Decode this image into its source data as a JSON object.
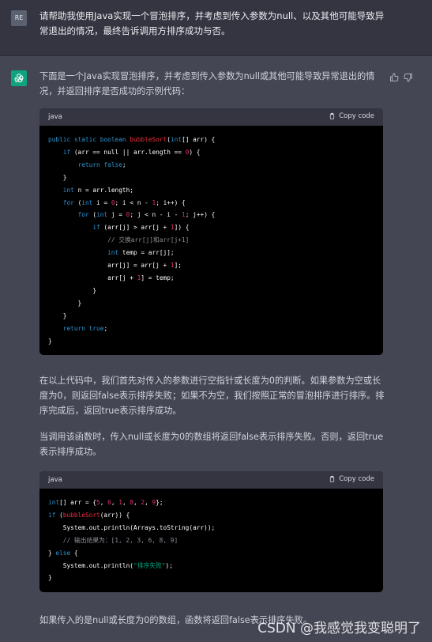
{
  "user": {
    "avatar_initials": "RE",
    "message": "请帮助我使用Java实现一个冒泡排序，并考虑到传入参数为null、以及其他可能导致异常退出的情况，最终告诉调用方排序成功与否。"
  },
  "assistant": {
    "intro": "下面是一个Java实现冒泡排序，并考虑到传入参数为null或其他可能导致异常退出的情况，并返回排序是否成功的示例代码：",
    "code_block_1": {
      "language": "java",
      "copy_label": "Copy code",
      "lines": [
        "public static boolean bubbleSort(int[] arr) {",
        "    if (arr == null || arr.length == 0) {",
        "        return false;",
        "    }",
        "    int n = arr.length;",
        "    for (int i = 0; i < n - 1; i++) {",
        "        for (int j = 0; j < n - i - 1; j++) {",
        "            if (arr[j] > arr[j + 1]) {",
        "                // 交换arr[j]和arr[j+1]",
        "                int temp = arr[j];",
        "                arr[j] = arr[j + 1];",
        "                arr[j + 1] = temp;",
        "            }",
        "        }",
        "    }",
        "    return true;",
        "}"
      ]
    },
    "para_1": "在以上代码中，我们首先对传入的参数进行空指针或长度为0的判断。如果参数为空或长度为0，则返回false表示排序失败；如果不为空，我们按照正常的冒泡排序进行排序。排序完成后，返回true表示排序成功。",
    "para_2": "当调用该函数时，传入null或长度为0的数组将返回false表示排序失败。否则，返回true表示排序成功。",
    "code_block_2": {
      "language": "java",
      "copy_label": "Copy code",
      "lines": [
        "int[] arr = {5, 6, 1, 8, 2, 9};",
        "if (bubbleSort(arr)) {",
        "    System.out.println(Arrays.toString(arr));",
        "    // 输出结果为：[1, 2, 3, 6, 8, 9]",
        "} else {",
        "    System.out.println(\"排序失败\");",
        "}"
      ]
    },
    "para_3": "如果传入的是null或长度为0的数组，函数将返回false表示排序失败。"
  },
  "watermark": "CSDN @我感觉我变聪明了",
  "colors": {
    "user_bg": "#343541",
    "assistant_bg": "#444654",
    "code_bg": "#000000",
    "keyword": "#2e95d3",
    "function": "#f22c3d",
    "number": "#df3079",
    "string": "#00a67d",
    "bot_avatar": "#10a37f"
  }
}
